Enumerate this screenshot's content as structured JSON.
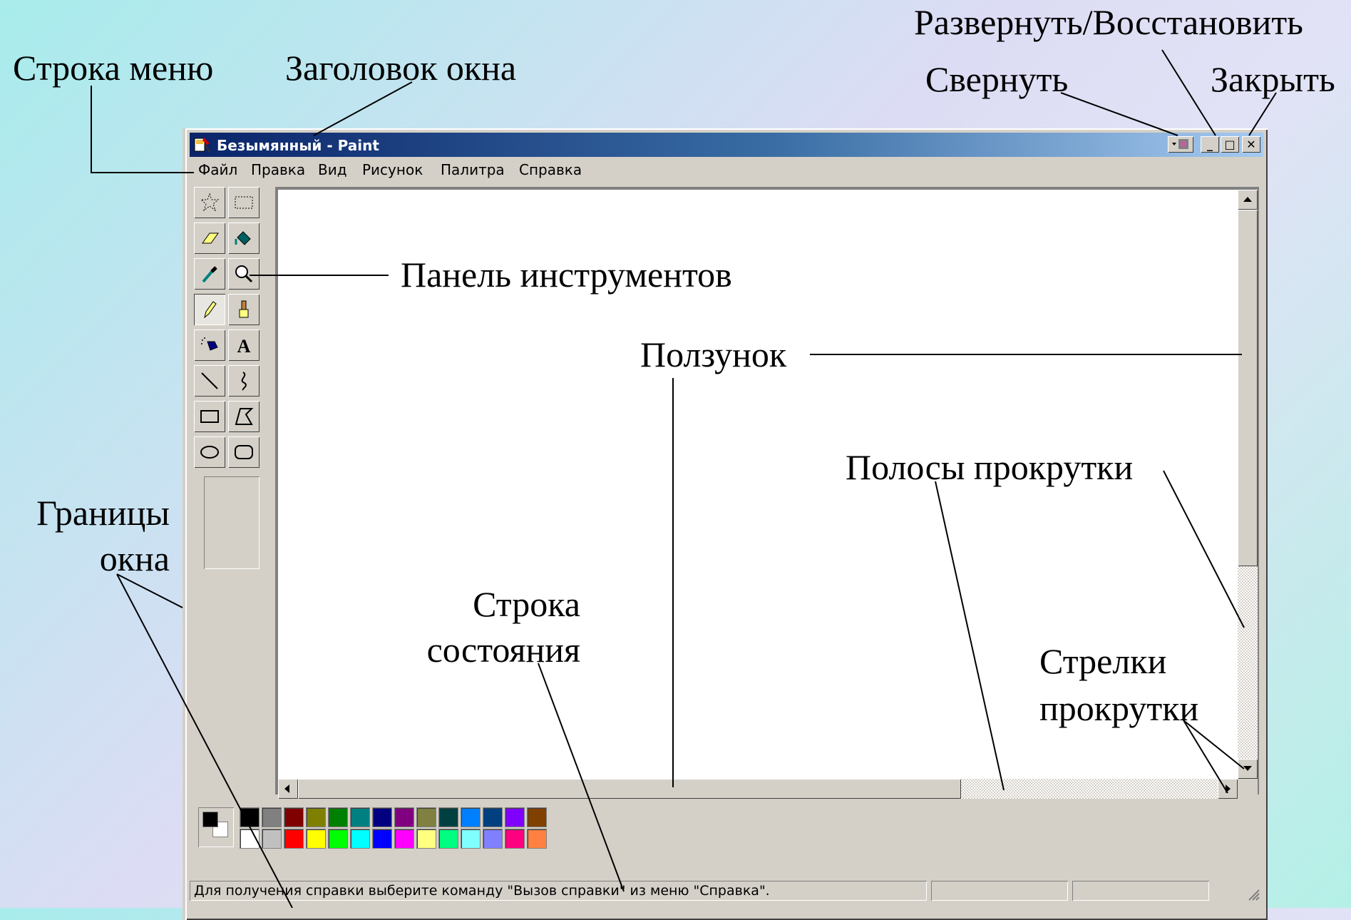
{
  "annotations": {
    "menu_bar": "Строка меню",
    "window_title": "Заголовок окна",
    "maximize_restore": "Развернуть/Восстановить",
    "minimize": "Свернуть",
    "close": "Закрыть",
    "toolbar_panel": "Панель инструментов",
    "slider": "Ползунок",
    "scrollbars": "Полосы прокрутки",
    "window_borders_line1": "Границы",
    "window_borders_line2": "окна",
    "status_bar_line1": "Строка",
    "status_bar_line2": "состояния",
    "scroll_arrows_line1": "Стрелки",
    "scroll_arrows_line2": "прокрутки"
  },
  "window": {
    "title": "Безымянный - Paint",
    "buttons": {
      "minimize": "_",
      "maximize": "□",
      "close": "✕"
    }
  },
  "menu": {
    "items": [
      "Файл",
      "Правка",
      "Вид",
      "Рисунок",
      "Палитра",
      "Справка"
    ]
  },
  "tools": [
    {
      "name": "free-select",
      "icon": "free-form-select-icon"
    },
    {
      "name": "rect-select",
      "icon": "rect-select-icon"
    },
    {
      "name": "eraser",
      "icon": "eraser-icon"
    },
    {
      "name": "fill",
      "icon": "paint-bucket-icon"
    },
    {
      "name": "picker",
      "icon": "color-picker-icon"
    },
    {
      "name": "magnifier",
      "icon": "magnifier-icon"
    },
    {
      "name": "pencil",
      "icon": "pencil-icon",
      "selected": true
    },
    {
      "name": "brush",
      "icon": "brush-icon"
    },
    {
      "name": "airbrush",
      "icon": "airbrush-icon"
    },
    {
      "name": "text",
      "icon": "text-icon",
      "glyph": "A"
    },
    {
      "name": "line",
      "icon": "line-icon"
    },
    {
      "name": "curve",
      "icon": "curve-icon"
    },
    {
      "name": "rectangle",
      "icon": "rectangle-icon"
    },
    {
      "name": "polygon",
      "icon": "polygon-icon"
    },
    {
      "name": "ellipse",
      "icon": "ellipse-icon"
    },
    {
      "name": "rounded-rect",
      "icon": "rounded-rectangle-icon"
    }
  ],
  "palette": {
    "foreground": "#000000",
    "background": "#ffffff",
    "row1": [
      "#000000",
      "#808080",
      "#800000",
      "#808000",
      "#008000",
      "#008080",
      "#000080",
      "#800080",
      "#808040",
      "#004040",
      "#0080ff",
      "#004080",
      "#8000ff",
      "#804000"
    ],
    "row2": [
      "#ffffff",
      "#c0c0c0",
      "#ff0000",
      "#ffff00",
      "#00ff00",
      "#00ffff",
      "#0000ff",
      "#ff00ff",
      "#ffff80",
      "#00ff80",
      "#80ffff",
      "#8080ff",
      "#ff0080",
      "#ff8040"
    ]
  },
  "status": {
    "text": "Для получения справки выберите команду \"Вызов справки\" из меню \"Справка\"."
  }
}
